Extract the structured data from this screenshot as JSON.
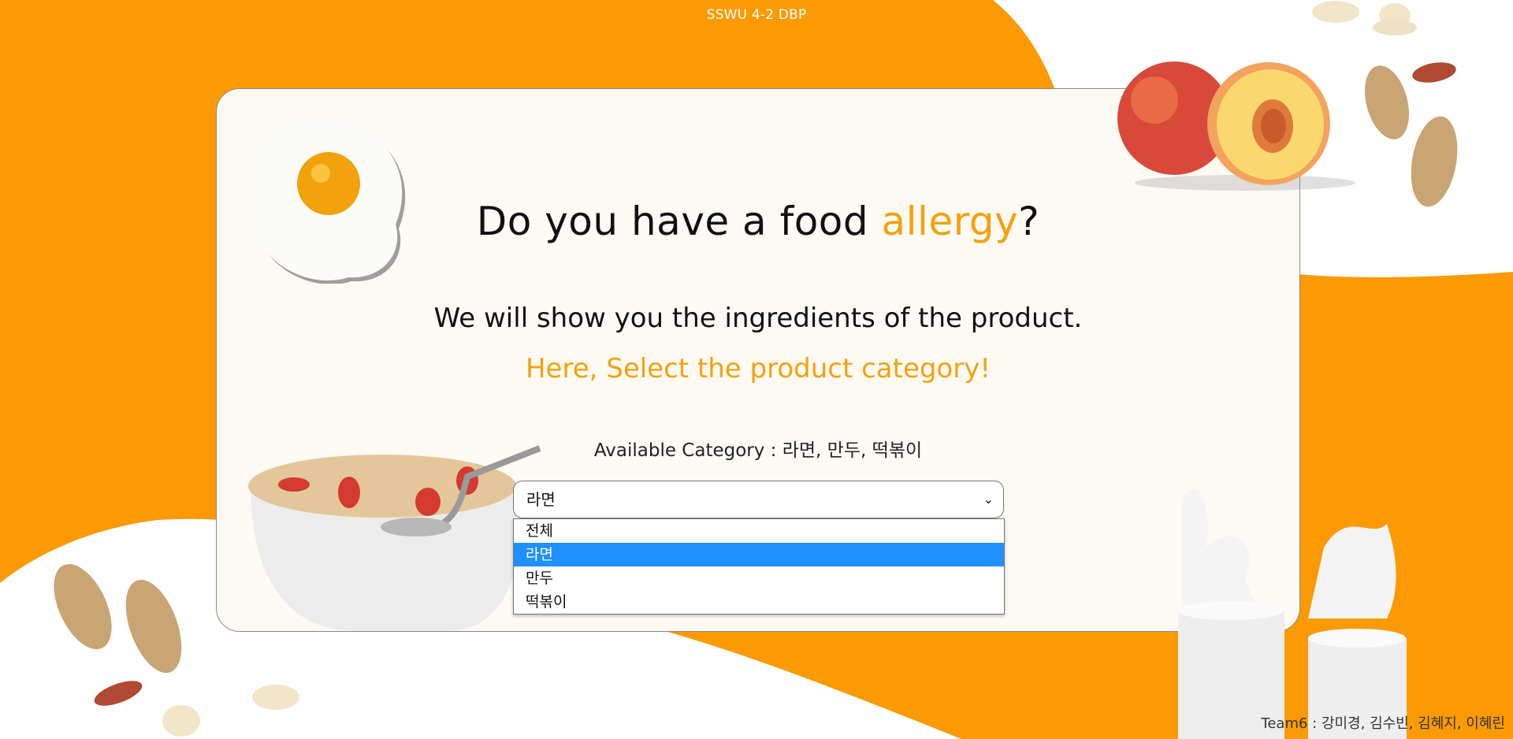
{
  "header": {
    "title": "SSWU 4-2 DBP"
  },
  "main": {
    "title_prefix": "Do you have a food ",
    "title_accent": "allergy",
    "title_suffix": "?",
    "subtitle": "We will show you the ingredients of the product.",
    "prompt": "Here, Select the product category!",
    "available": "Available Category : 라면, 만두, 떡볶이"
  },
  "category_select": {
    "selected": "라면",
    "options": [
      "전체",
      "라면",
      "만두",
      "떡볶이"
    ],
    "highlighted_index": 1
  },
  "footer": {
    "credits": "Team6 : 강미경, 김수빈, 김혜지, 이혜린"
  },
  "colors": {
    "orange": "#fb9a05",
    "accent": "#f6a10c",
    "card": "#fdfaf4",
    "highlight": "#1e90ff"
  },
  "images": [
    "fried-egg-image",
    "peach-image",
    "peanut-image",
    "oatmeal-bowl-image",
    "milk-splash-image"
  ]
}
